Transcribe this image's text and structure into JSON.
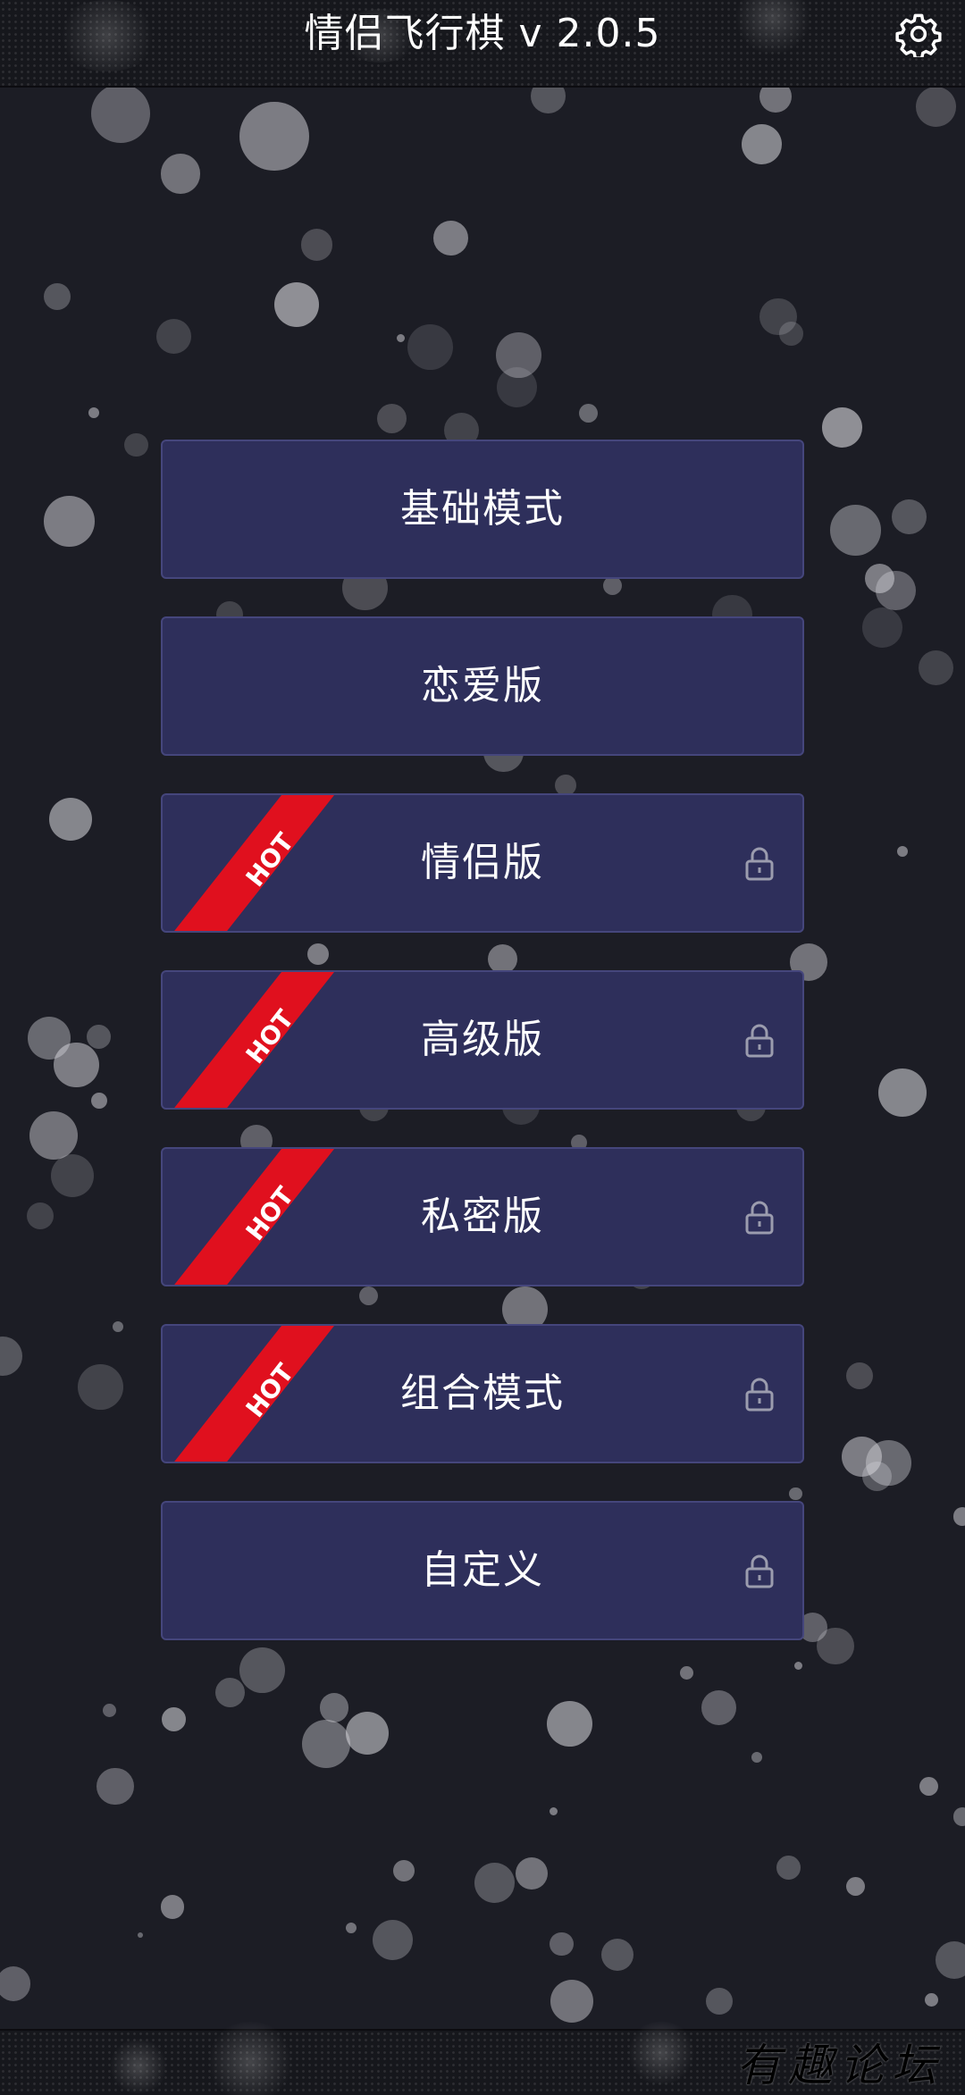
{
  "header": {
    "title": "情侣飞行棋 v 2.0.5",
    "settings_icon": "gear-icon"
  },
  "modes": [
    {
      "label": "基础模式",
      "hot": false,
      "locked": false
    },
    {
      "label": "恋爱版",
      "hot": false,
      "locked": false
    },
    {
      "label": "情侣版",
      "hot": true,
      "locked": true
    },
    {
      "label": "高级版",
      "hot": true,
      "locked": true
    },
    {
      "label": "私密版",
      "hot": true,
      "locked": true
    },
    {
      "label": "组合模式",
      "hot": true,
      "locked": true
    },
    {
      "label": "自定义",
      "hot": false,
      "locked": true
    }
  ],
  "badge": {
    "hot_text": "HOT"
  },
  "watermark": "有趣论坛",
  "colors": {
    "background": "#1c1d25",
    "button_bg": "#2e2f5b",
    "button_border": "#45467c",
    "hot_ribbon": "#e0101e",
    "text": "#ffffff",
    "lock": "#9b9cae"
  }
}
